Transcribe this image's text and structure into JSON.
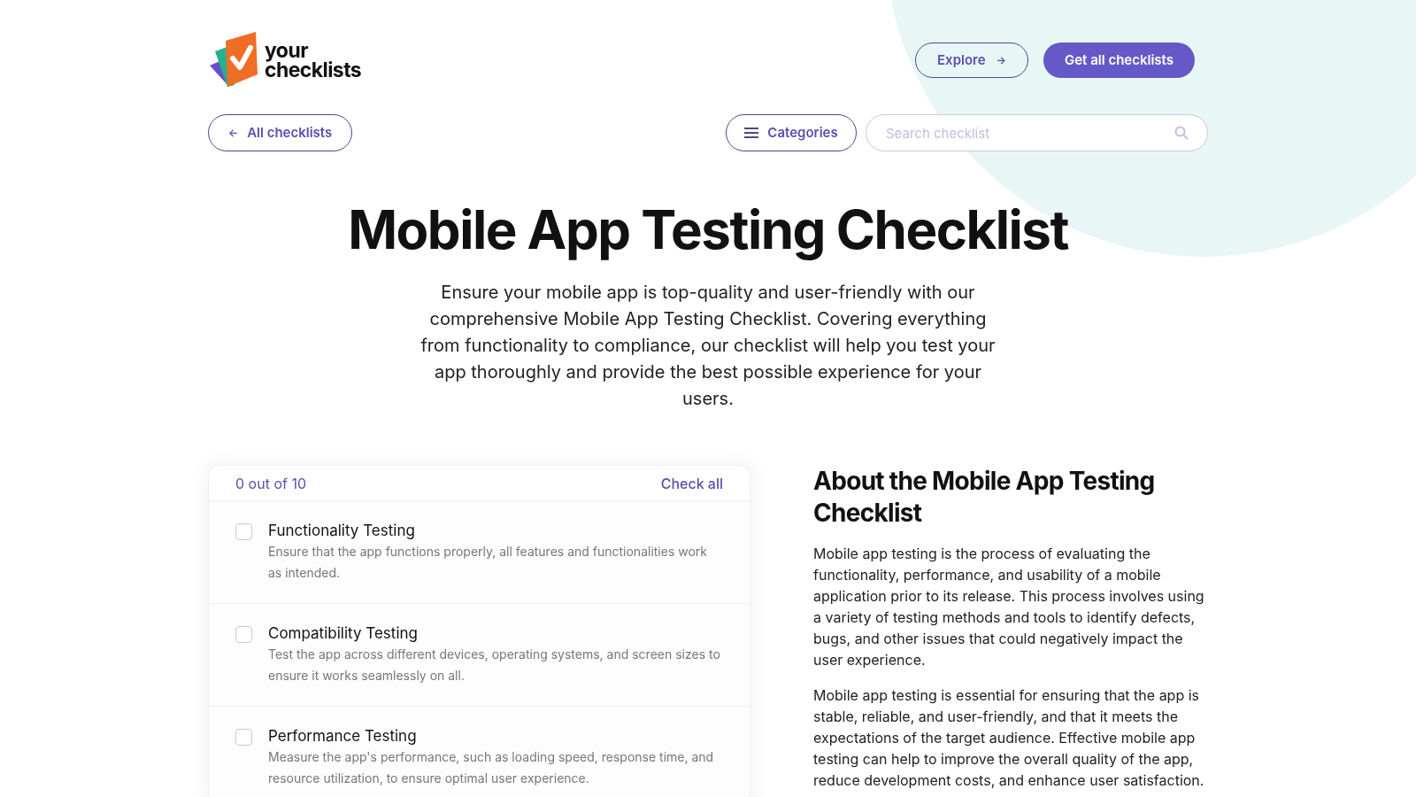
{
  "logo": {
    "line_1": "your",
    "line_2": "checklists"
  },
  "header": {
    "explore": "Explore",
    "arrow": "→",
    "get_all": "Get all checklists"
  },
  "toolbar": {
    "back_arrow": "←",
    "all_checklists": "All checklists",
    "categories": "Categories",
    "search": {
      "placeholder": "Search checklist"
    }
  },
  "hero": {
    "title": "Mobile App Testing Checklist",
    "intro": "Ensure your mobile app is top-quality and user-friendly with our comprehensive Mobile App Testing Checklist. Covering everything from functionality to compliance, our checklist will help you test your app thoroughly and provide the best possible experience for your users."
  },
  "checklist": {
    "progress": "0 out of 10",
    "check_all": "Check all",
    "items": [
      {
        "title": "Functionality Testing",
        "description": "Ensure that the app functions properly, all features and functionalities work as intended.",
        "checked": false
      },
      {
        "title": "Compatibility Testing",
        "description": "Test the app across different devices, operating systems, and screen sizes to ensure it works seamlessly on all.",
        "checked": false
      },
      {
        "title": "Performance Testing",
        "description": "Measure the app's performance, such as loading speed, response time, and resource utilization, to ensure optimal user experience.",
        "checked": false
      }
    ]
  },
  "about": {
    "heading": "About the Mobile App Testing Checklist",
    "paragraphs": [
      "Mobile app testing is the process of evaluating the functionality, performance, and usability of a mobile application prior to its release. This process involves using a variety of testing methods and tools to identify defects, bugs, and other issues that could negatively impact the user experience.",
      "Mobile app testing is essential for ensuring that the app is stable, reliable, and user-friendly, and that it meets the expectations of the target audience. Effective mobile app testing can help to improve the overall quality of the app, reduce development costs, and enhance user satisfaction."
    ]
  }
}
